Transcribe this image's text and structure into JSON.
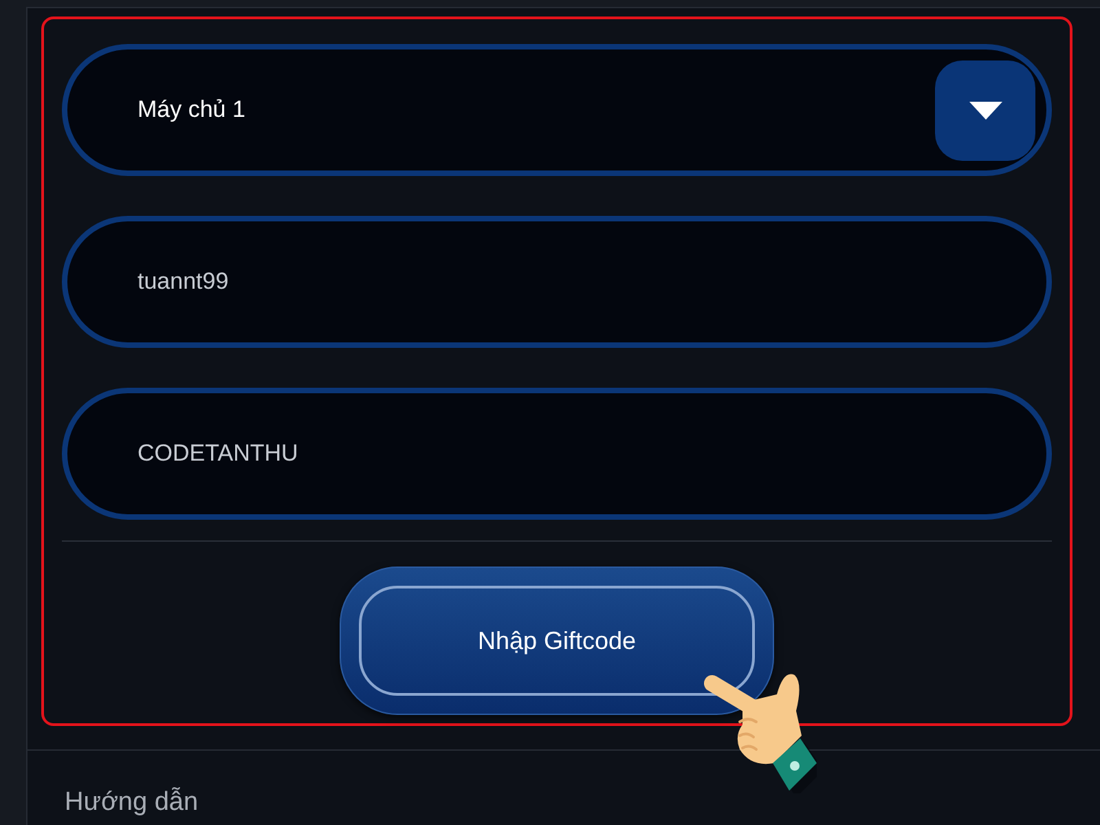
{
  "server_select": {
    "value": "Máy chủ 1"
  },
  "fields": [
    {
      "value": "tuannt99"
    },
    {
      "value": "CODETANTHU"
    }
  ],
  "submit_button": {
    "label": "Nhập Giftcode"
  },
  "guide_section": {
    "title": "Hướng dẫn"
  }
}
